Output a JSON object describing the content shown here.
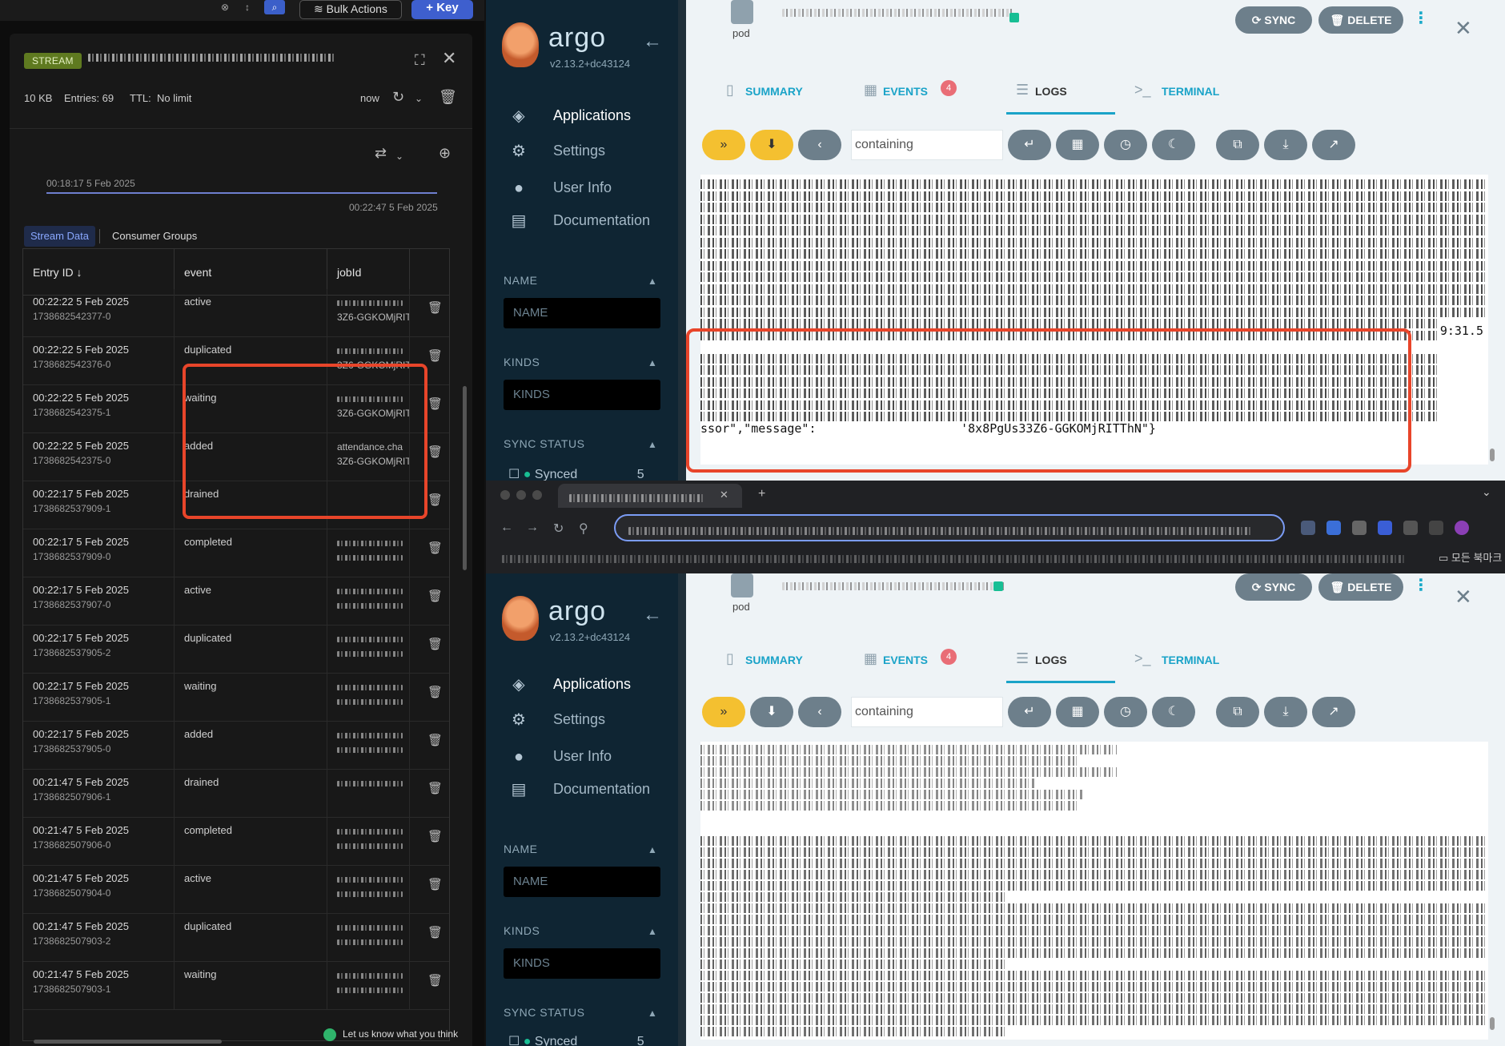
{
  "left": {
    "toolbar": {
      "bulk_actions": "Bulk Actions",
      "add_key": "+ Key"
    },
    "key": {
      "type_badge": "STREAM"
    },
    "meta": {
      "size": "10 KB",
      "entries": "Entries: 69",
      "ttl_label": "TTL:",
      "ttl_value": "No limit",
      "refresh_time": "now"
    },
    "timeline": {
      "start": "00:18:17 5 Feb 2025",
      "end": "00:22:47 5 Feb 2025"
    },
    "tabs": {
      "stream_data": "Stream Data",
      "consumer_groups": "Consumer Groups"
    },
    "table": {
      "headers": {
        "entry_id": "Entry ID ↓",
        "event": "event",
        "jobid": "jobId"
      },
      "rows": [
        {
          "date": "00:22:22 5 Feb 2025",
          "id": "1738682542377-0",
          "event": "active",
          "job2": "3Z6-GGKOMjRIT"
        },
        {
          "date": "00:22:22 5 Feb 2025",
          "id": "1738682542376-0",
          "event": "duplicated",
          "job2": "3Z6-GGKOMjRIT"
        },
        {
          "date": "00:22:22 5 Feb 2025",
          "id": "1738682542375-1",
          "event": "waiting",
          "job2": "3Z6-GGKOMjRIT"
        },
        {
          "date": "00:22:22 5 Feb 2025",
          "id": "1738682542375-0",
          "event": "added",
          "job1": "attendance.cha",
          "job2": "3Z6-GGKOMjRIT"
        },
        {
          "date": "00:22:17 5 Feb 2025",
          "id": "1738682537909-1",
          "event": "drained"
        },
        {
          "date": "00:22:17 5 Feb 2025",
          "id": "1738682537909-0",
          "event": "completed"
        },
        {
          "date": "00:22:17 5 Feb 2025",
          "id": "1738682537907-0",
          "event": "active"
        },
        {
          "date": "00:22:17 5 Feb 2025",
          "id": "1738682537905-2",
          "event": "duplicated"
        },
        {
          "date": "00:22:17 5 Feb 2025",
          "id": "1738682537905-1",
          "event": "waiting"
        },
        {
          "date": "00:22:17 5 Feb 2025",
          "id": "1738682537905-0",
          "event": "added"
        },
        {
          "date": "00:21:47 5 Feb 2025",
          "id": "1738682507906-1",
          "event": "drained"
        },
        {
          "date": "00:21:47 5 Feb 2025",
          "id": "1738682507906-0",
          "event": "completed"
        },
        {
          "date": "00:21:47 5 Feb 2025",
          "id": "1738682507904-0",
          "event": "active"
        },
        {
          "date": "00:21:47 5 Feb 2025",
          "id": "1738682507903-2",
          "event": "duplicated"
        },
        {
          "date": "00:21:47 5 Feb 2025",
          "id": "1738682507903-1",
          "event": "waiting"
        }
      ]
    },
    "feedback": "Let us know what you think"
  },
  "argo": {
    "brand": "argo",
    "version": "v2.13.2+dc43124",
    "nav": {
      "applications": "Applications",
      "settings": "Settings",
      "user_info": "User Info",
      "documentation": "Documentation"
    },
    "filters": {
      "name_head": "NAME",
      "name_placeholder": "NAME",
      "kinds_head": "KINDS",
      "kinds_placeholder": "KINDS",
      "sync_head": "SYNC STATUS",
      "synced": "Synced",
      "synced_count": "5"
    },
    "pod_label": "pod",
    "actions": {
      "sync": "SYNC",
      "delete": "DELETE"
    },
    "tabs": {
      "summary": "SUMMARY",
      "events": "EVENTS",
      "events_count": "4",
      "logs": "LOGS",
      "terminal": "TERMINAL"
    },
    "filter_value": "containing",
    "log_tail": "9:31.5",
    "log_message": "ssor\",\"message\":                    '8x8PgUs33Z6-GGKOMjRITThN\"}"
  },
  "chrome": {
    "bookmarks_folder": "모든 북마크"
  },
  "colors": {
    "highlight": "#e8452a",
    "argo_accent": "#1aa3c8",
    "stream_badge": "#5f7a20",
    "primary_button": "#3e5fce"
  }
}
